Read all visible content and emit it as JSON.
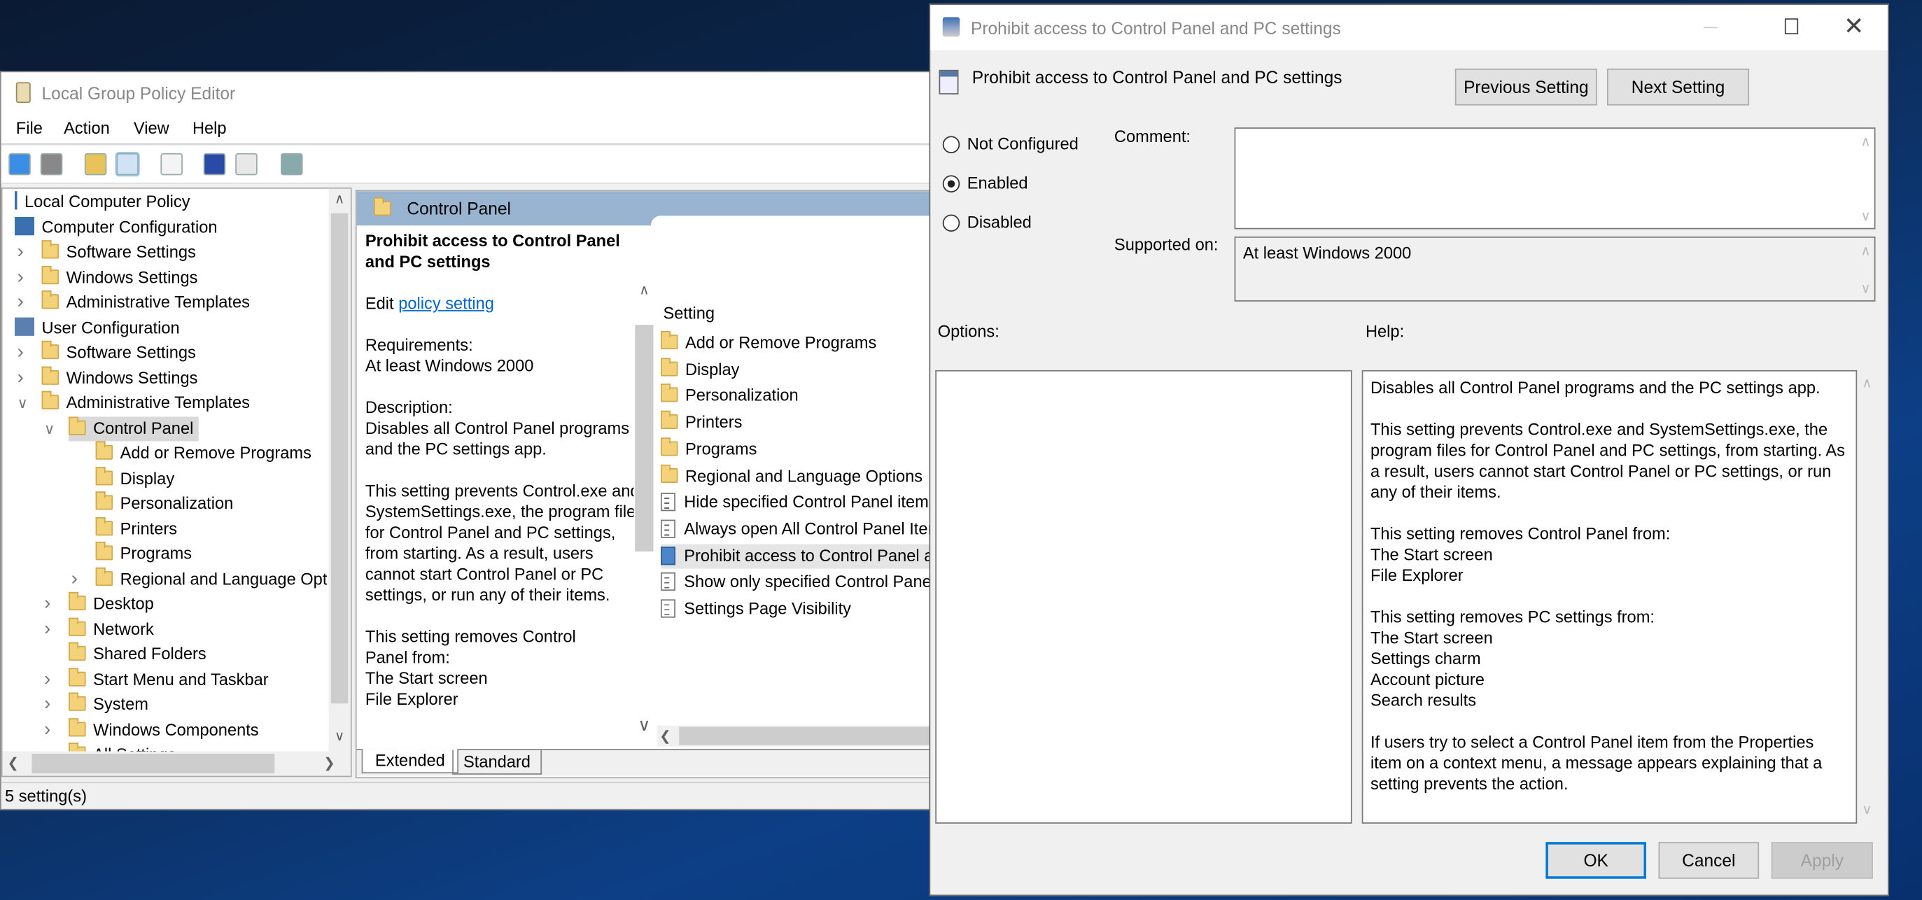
{
  "gpe": {
    "title": "Local Group Policy Editor",
    "menu": [
      "File",
      "Action",
      "View",
      "Help"
    ],
    "toolbar_icons": [
      "back-arrow-icon",
      "forward-arrow-icon",
      "up-folder-icon",
      "show-hide-tree-icon",
      "export-list-icon",
      "help-icon",
      "show-hide-action-pane-icon",
      "filter-icon"
    ],
    "tree": [
      {
        "label": "Local Computer Policy",
        "level": 0,
        "icon": "policy",
        "expander": ""
      },
      {
        "label": "Computer Configuration",
        "level": 0,
        "icon": "computer",
        "expander": ""
      },
      {
        "label": "Software Settings",
        "level": 1,
        "icon": "folder",
        "expander": ">"
      },
      {
        "label": "Windows Settings",
        "level": 1,
        "icon": "folder",
        "expander": ">"
      },
      {
        "label": "Administrative Templates",
        "level": 1,
        "icon": "folder",
        "expander": ">"
      },
      {
        "label": "User Configuration",
        "level": 0,
        "icon": "user",
        "expander": ""
      },
      {
        "label": "Software Settings",
        "level": 1,
        "icon": "folder",
        "expander": ">"
      },
      {
        "label": "Windows Settings",
        "level": 1,
        "icon": "folder",
        "expander": ">"
      },
      {
        "label": "Administrative Templates",
        "level": 1,
        "icon": "folder",
        "expander": "v"
      },
      {
        "label": "Control Panel",
        "level": 2,
        "icon": "folder",
        "expander": "v",
        "selected": true
      },
      {
        "label": "Add or Remove Programs",
        "level": 3,
        "icon": "folder",
        "expander": ""
      },
      {
        "label": "Display",
        "level": 3,
        "icon": "folder",
        "expander": ""
      },
      {
        "label": "Personalization",
        "level": 3,
        "icon": "folder",
        "expander": ""
      },
      {
        "label": "Printers",
        "level": 3,
        "icon": "folder",
        "expander": ""
      },
      {
        "label": "Programs",
        "level": 3,
        "icon": "folder",
        "expander": ""
      },
      {
        "label": "Regional and Language Opt",
        "level": 3,
        "icon": "folder",
        "expander": ">"
      },
      {
        "label": "Desktop",
        "level": 2,
        "icon": "folder",
        "expander": ">"
      },
      {
        "label": "Network",
        "level": 2,
        "icon": "folder",
        "expander": ">"
      },
      {
        "label": "Shared Folders",
        "level": 2,
        "icon": "folder",
        "expander": ""
      },
      {
        "label": "Start Menu and Taskbar",
        "level": 2,
        "icon": "folder",
        "expander": ">"
      },
      {
        "label": "System",
        "level": 2,
        "icon": "folder",
        "expander": ">"
      },
      {
        "label": "Windows Components",
        "level": 2,
        "icon": "folder",
        "expander": ">"
      },
      {
        "label": "All Settings",
        "level": 2,
        "icon": "folder",
        "expander": ""
      }
    ],
    "header": "Control Panel",
    "desc": {
      "title": "Prohibit access to Control Panel and PC settings",
      "edit_prefix": "Edit ",
      "edit_link": "policy setting",
      "requirements_label": "Requirements:",
      "requirements": "At least Windows 2000",
      "description_label": "Description:",
      "p1": "Disables all Control Panel programs and the PC settings app.",
      "p2": "This setting prevents Control.exe and SystemSettings.exe, the program files for Control Panel and PC settings, from starting. As a result, users cannot start Control Panel or PC settings, or run any of their items.",
      "p3a": "This setting removes Control Panel from:",
      "p3b": "The Start screen",
      "p3c": "File Explorer"
    },
    "list_header": "Setting",
    "list": [
      {
        "label": "Add or Remove Programs",
        "icon": "folder"
      },
      {
        "label": "Display",
        "icon": "folder"
      },
      {
        "label": "Personalization",
        "icon": "folder"
      },
      {
        "label": "Printers",
        "icon": "folder"
      },
      {
        "label": "Programs",
        "icon": "folder"
      },
      {
        "label": "Regional and Language Options",
        "icon": "folder"
      },
      {
        "label": "Hide specified Control Panel items",
        "icon": "policy"
      },
      {
        "label": "Always open All Control Panel Items",
        "icon": "policy"
      },
      {
        "label": "Prohibit access to Control Panel and PC settings",
        "icon": "policy",
        "selected": true
      },
      {
        "label": "Show only specified Control Panel items",
        "icon": "policy"
      },
      {
        "label": "Settings Page Visibility",
        "icon": "policy"
      }
    ],
    "tabs": [
      "Extended",
      "Standard"
    ],
    "active_tab": "Extended",
    "status": "5 setting(s)"
  },
  "dialog": {
    "title": "Prohibit access to Control Panel and PC settings",
    "heading": "Prohibit access to Control Panel and PC settings",
    "prev_button": "Previous Setting",
    "next_button": "Next Setting",
    "radios": [
      {
        "label": "Not Configured",
        "checked": false
      },
      {
        "label": "Enabled",
        "checked": true
      },
      {
        "label": "Disabled",
        "checked": false
      }
    ],
    "comment_label": "Comment:",
    "comment_value": "",
    "supported_label": "Supported on:",
    "supported_value": "At least Windows 2000",
    "options_label": "Options:",
    "help_label": "Help:",
    "help": [
      "Disables all Control Panel programs and the PC settings app.",
      "This setting prevents Control.exe and SystemSettings.exe, the program files for Control Panel and PC settings, from starting. As a result, users cannot start Control Panel or PC settings, or run any of their items.",
      "This setting removes Control Panel from:\nThe Start screen\nFile Explorer",
      "This setting removes PC settings from:\nThe Start screen\nSettings charm\nAccount picture\nSearch results",
      "If users try to select a Control Panel item from the Properties item on a context menu, a message appears explaining that a setting prevents the action."
    ],
    "ok": "OK",
    "cancel": "Cancel",
    "apply": "Apply",
    "apply_enabled": false
  },
  "colors": {
    "header_band": "#99b4d1",
    "selection": "#d9d9d9",
    "link": "#0066cc",
    "ok_border": "#0078d7"
  }
}
